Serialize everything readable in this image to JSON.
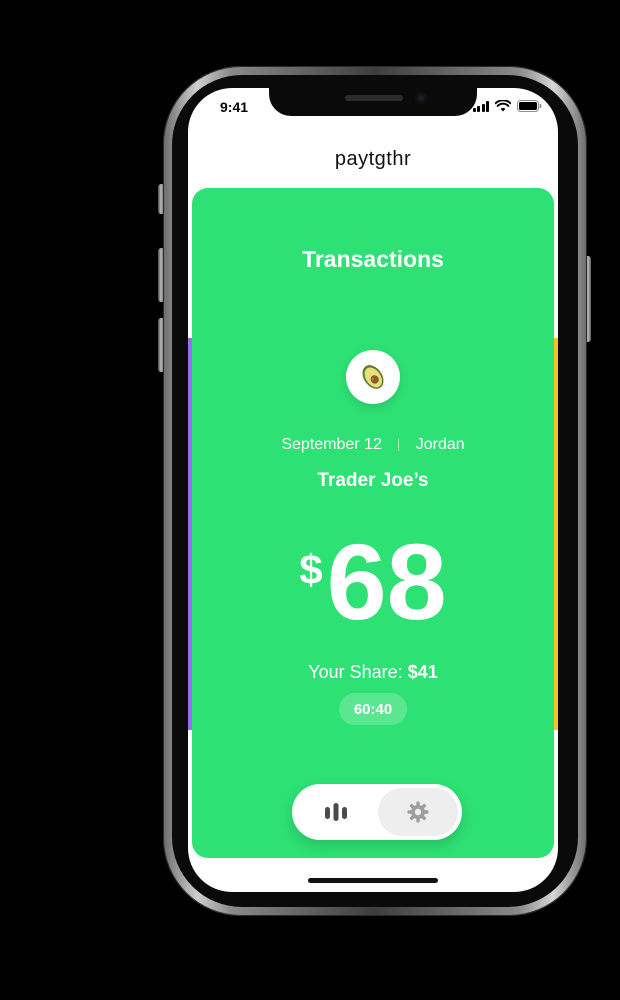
{
  "status_bar": {
    "time": "9:41"
  },
  "app": {
    "brand": "paytgthr"
  },
  "card": {
    "title": "Transactions",
    "avatar_icon": "avocado-icon",
    "date": "September 12",
    "person": "Jordan",
    "merchant": "Trader Joe’s",
    "currency_symbol": "$",
    "amount": "68",
    "share_label": "Your Share:",
    "share_value": "$41",
    "split_ratio": "60:40"
  },
  "nav": {
    "items": [
      {
        "icon": "chart-bars-icon",
        "selected": false
      },
      {
        "icon": "gear-icon",
        "selected": true
      }
    ]
  },
  "colors": {
    "card_green": "#2ee174",
    "side_card_purple": "#9b6cf6",
    "side_card_yellow": "#f8c12a"
  }
}
